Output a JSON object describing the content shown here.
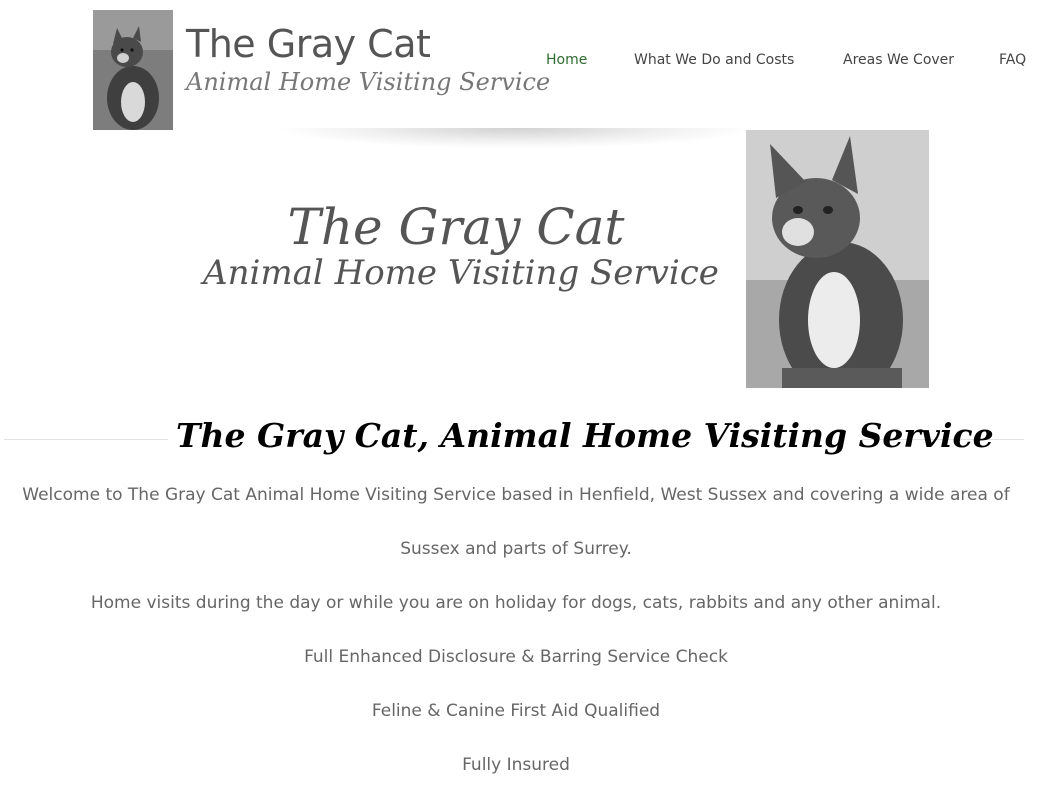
{
  "header": {
    "logo_title": "The Gray Cat",
    "logo_tagline": "Animal Home Visiting Service"
  },
  "nav": {
    "items": [
      {
        "label": "Home",
        "active": true
      },
      {
        "label": "What We Do and Costs",
        "active": false
      },
      {
        "label": "Areas We Cover",
        "active": false
      },
      {
        "label": "FAQ",
        "active": false
      }
    ],
    "active_color": "#2e6b2e"
  },
  "hero": {
    "title": "The Gray Cat",
    "subtitle": "Animal Home Visiting Service"
  },
  "main": {
    "heading": "The Gray Cat, Animal Home Visiting Service",
    "paragraphs": [
      "Welcome to The Gray Cat Animal Home Visiting Service based in Henfield, West Sussex and covering a wide area of",
      "Sussex and parts of Surrey.",
      "Home visits during the day or while you are on holiday for dogs, cats, rabbits and any other animal.",
      "Full Enhanced Disclosure & Barring Service Check",
      "Feline & Canine First Aid Qualified",
      "Fully Insured"
    ]
  }
}
